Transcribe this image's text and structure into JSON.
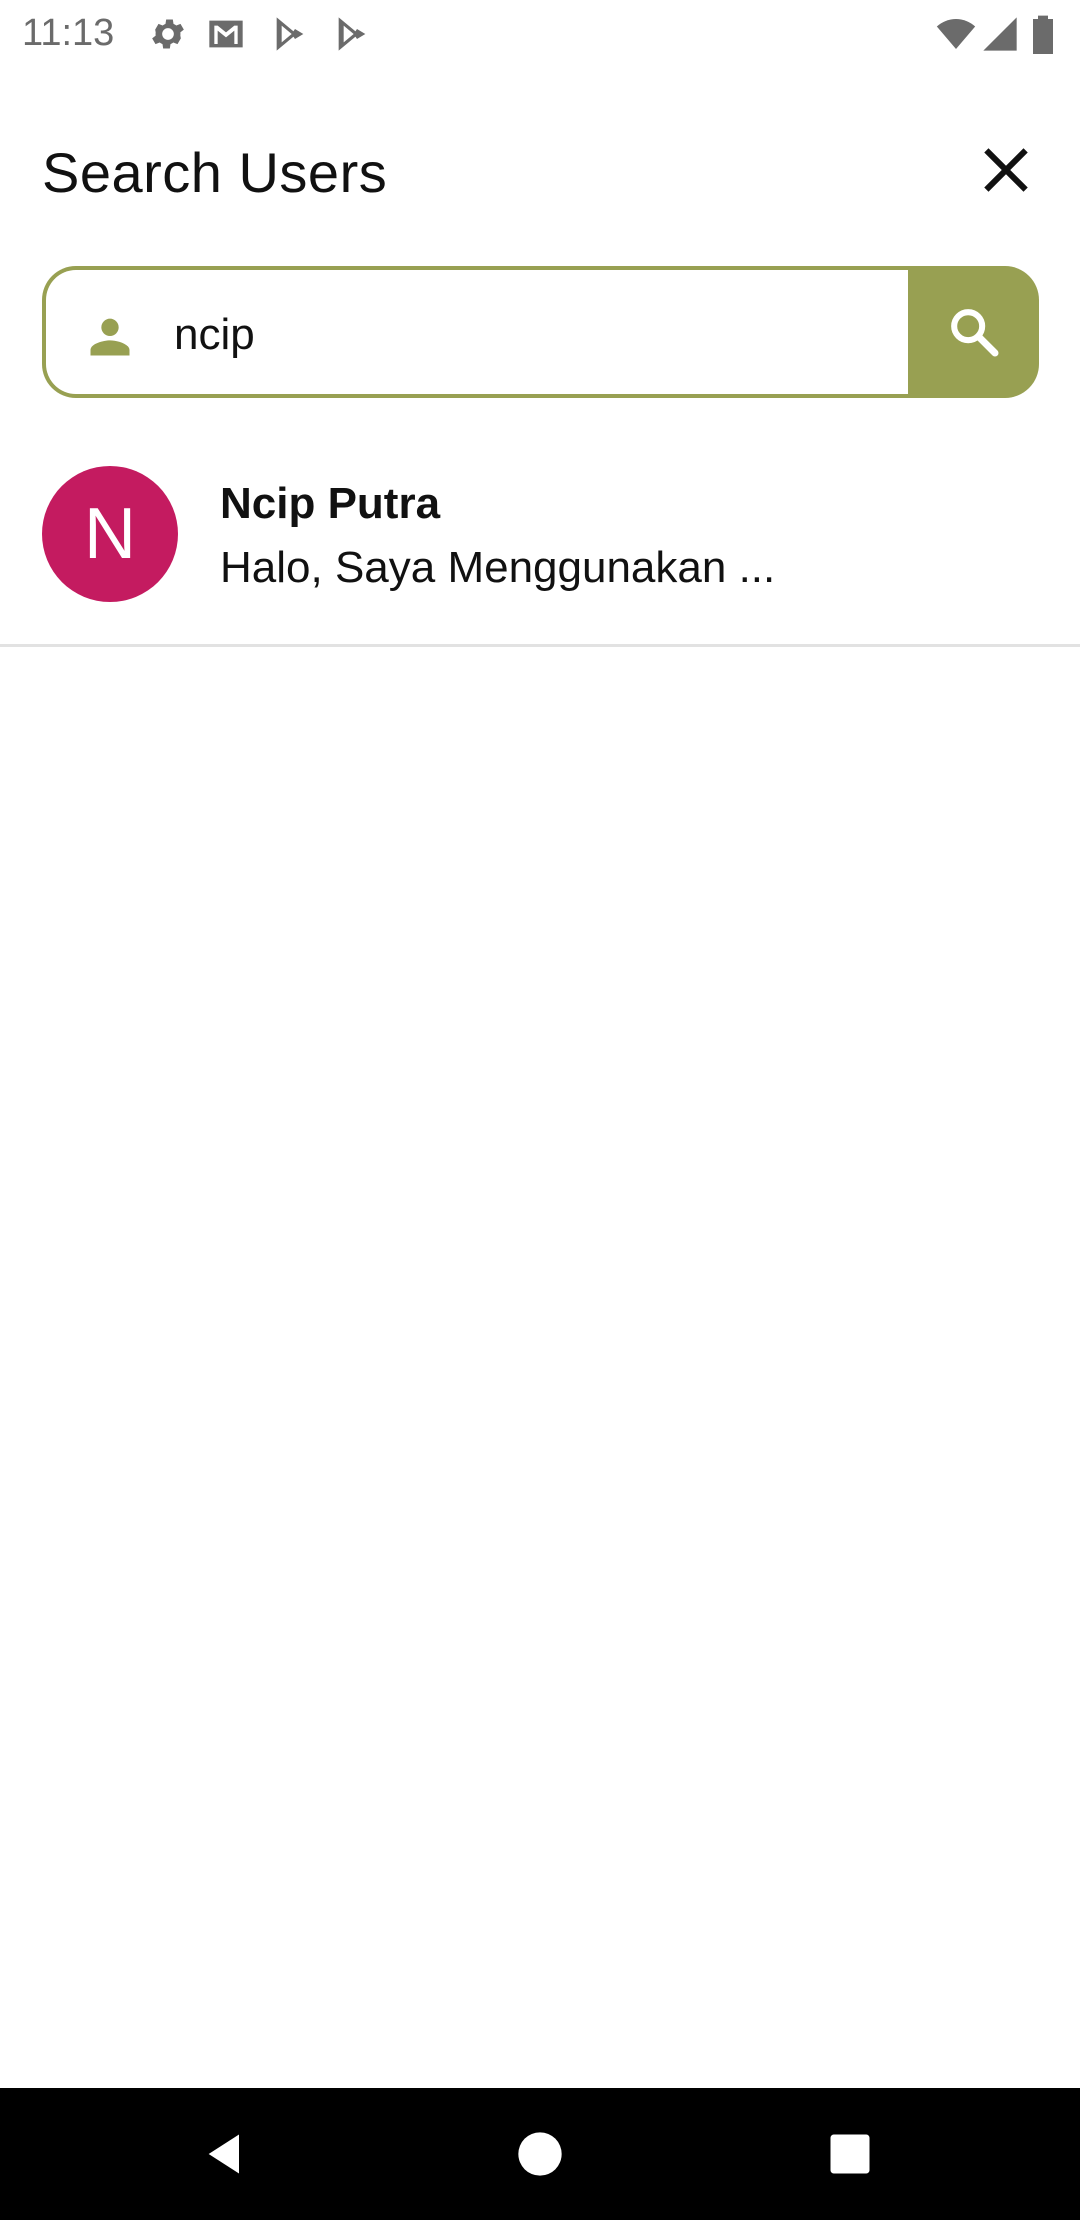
{
  "status_bar": {
    "time": "11:13",
    "icons": [
      "settings-icon",
      "gmail-icon",
      "play-store-icon",
      "play-store-icon",
      "wifi-icon",
      "signal-icon",
      "battery-icon"
    ]
  },
  "header": {
    "title": "Search Users",
    "close_icon": "close-icon"
  },
  "search": {
    "value": "ncip",
    "leading_icon": "person-icon",
    "button_icon": "search-icon",
    "accent_color": "#98a052"
  },
  "results": [
    {
      "avatar_letter": "N",
      "avatar_color": "#c41b60",
      "name": "Ncip Putra",
      "subtitle": "Halo, Saya Menggunakan ..."
    }
  ],
  "nav_bar": {
    "icons": [
      "back-icon",
      "home-icon",
      "recents-icon"
    ]
  }
}
